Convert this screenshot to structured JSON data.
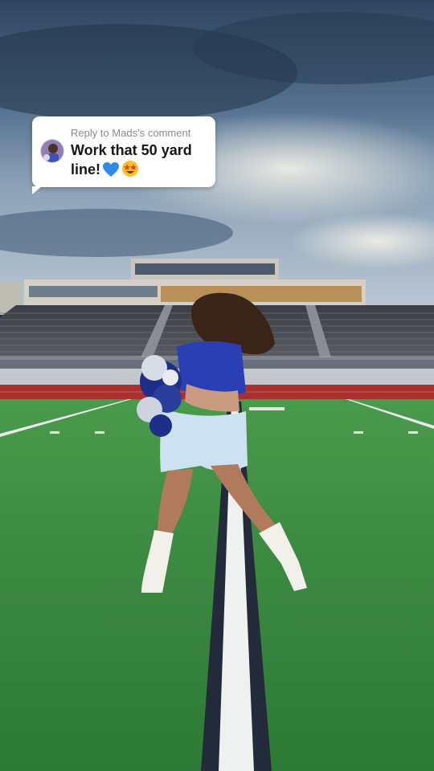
{
  "reply_sticker": {
    "caption": "Reply to Mads’s comment",
    "comment_text": "Work that 50 yard line!",
    "emojis": [
      "blue-heart-emoji",
      "star-struck-emoji"
    ]
  },
  "colors": {
    "sky": "#4a6a8c",
    "turf": "#3e8a42",
    "track": "#a8302e",
    "uniform": "#2b3fb5"
  }
}
